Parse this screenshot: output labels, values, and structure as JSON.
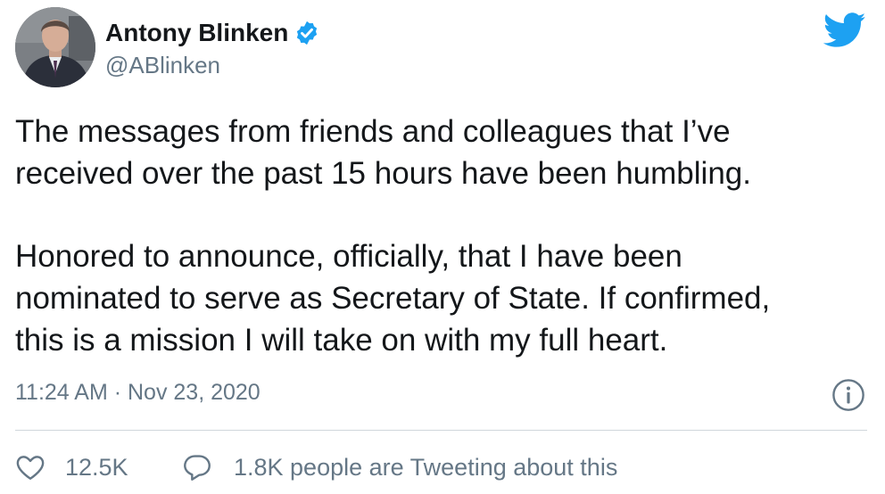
{
  "author": {
    "name": "Antony Blinken",
    "handle": "@ABlinken"
  },
  "tweet": {
    "paragraphs": [
      [
        "The messages from friends and colleagues that I’ve",
        "received over the past 15 hours have been humbling."
      ],
      [
        "Honored to announce, officially, that I have been",
        "nominated to serve as Secretary of State. If confirmed,",
        "this is a mission I will take on with my full heart."
      ]
    ],
    "timestamp": "11:24 AM · Nov 23, 2020"
  },
  "actions": {
    "likes": "12.5K",
    "conversation": "1.8K people are Tweeting about this"
  },
  "colors": {
    "text": "#14171a",
    "secondary": "#657786",
    "twitter_blue": "#1da1f2",
    "divider": "#d0d7dc"
  },
  "icons": [
    "verified-badge-icon",
    "twitter-bird-icon",
    "info-icon",
    "heart-icon",
    "speech-bubble-icon"
  ]
}
